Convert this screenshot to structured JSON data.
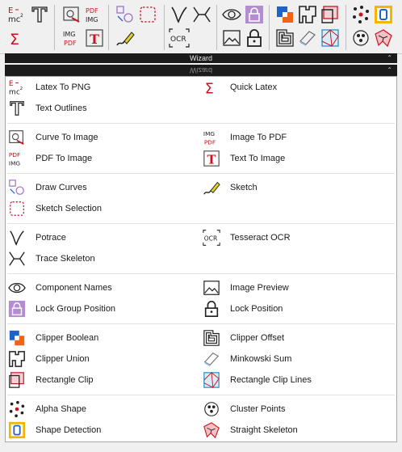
{
  "toolbar": {
    "mc_label": "mc",
    "e_label": "E",
    "pdf_img_label": "PDF",
    "img_label": "IMG",
    "ocr_label": "OCR"
  },
  "group_bar": {
    "title": "Wizard",
    "arrow": "⌃"
  },
  "menu_title": {
    "title": "Wizard",
    "arrow": "⌃"
  },
  "menu": {
    "latex_to_png": "Latex To PNG",
    "quick_latex": "Quick Latex",
    "text_outlines": "Text Outlines",
    "curve_to_image": "Curve To Image",
    "image_to_pdf": "Image To PDF",
    "pdf_to_image": "PDF To Image",
    "text_to_image": "Text To Image",
    "draw_curves": "Draw Curves",
    "sketch": "Sketch",
    "sketch_selection": "Sketch Selection",
    "potrace": "Potrace",
    "tesseract_ocr": "Tesseract OCR",
    "trace_skeleton": "Trace Skeleton",
    "component_names": "Component Names",
    "image_preview": "Image Preview",
    "lock_group_position": "Lock Group Position",
    "lock_position": "Lock Position",
    "clipper_boolean": "Clipper Boolean",
    "clipper_offset": "Clipper Offset",
    "clipper_union": "Clipper Union",
    "minkowski_sum": "Minkowski Sum",
    "rectangle_clip": "Rectangle Clip",
    "rectangle_clip_lines": "Rectangle Clip Lines",
    "alpha_shape": "Alpha Shape",
    "cluster_points": "Cluster Points",
    "shape_detection": "Shape Detection",
    "straight_skeleton": "Straight Skeleton"
  },
  "icon_text": {
    "e_letter": "E",
    "mc2": "mc",
    "sq": "2",
    "sigma": "Σ",
    "pdf": "PDF",
    "img": "IMG",
    "t_red": "T",
    "ocr": "OCR"
  },
  "colors": {
    "purple": "#a070c8",
    "red": "#c8141e",
    "blue": "#1e64c8",
    "orange": "#f06414",
    "teal": "#2a8fbf"
  }
}
